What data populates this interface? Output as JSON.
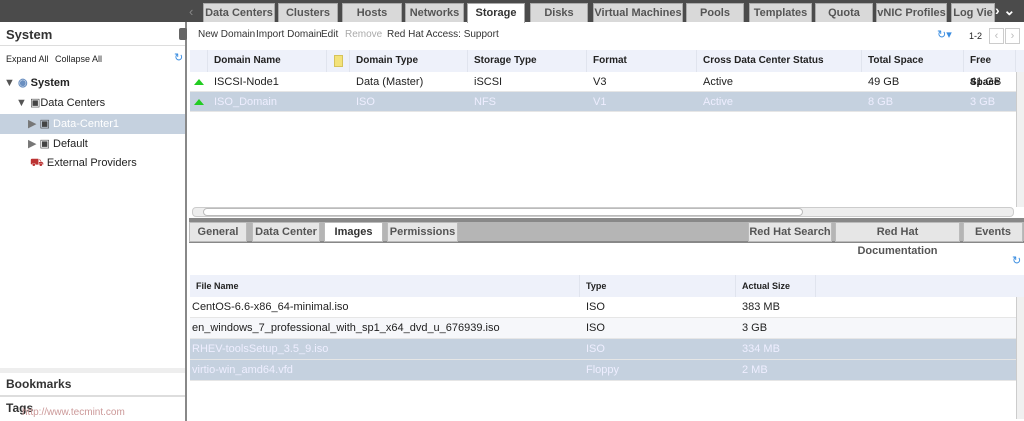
{
  "main_tabs": [
    "Data Centers",
    "Clusters",
    "Hosts",
    "Networks",
    "Storage",
    "Disks",
    "Virtual Machines",
    "Pools",
    "Templates",
    "Quota",
    "vNIC Profiles",
    "Log Vie"
  ],
  "active_tab": "Storage",
  "left": {
    "title": "System",
    "expand_all": "Expand All",
    "collapse_all": "Collapse All",
    "tree": [
      "System",
      "Data Centers",
      "Data-Center1",
      "Default",
      "External Providers"
    ],
    "bookmarks": "Bookmarks",
    "tags": "Tags"
  },
  "toolbar": {
    "new_domain": "New Domain",
    "import_domain": "Import Domain",
    "edit": "Edit",
    "remove": "Remove",
    "support": "Red Hat Access: Support",
    "pager": "1-2"
  },
  "storage_table": {
    "headers": [
      "Domain Name",
      "Domain Type",
      "Storage Type",
      "Format",
      "Cross Data Center Status",
      "Total Space",
      "Free Space"
    ],
    "rows": [
      [
        "ISCSI-Node1",
        "Data (Master)",
        "iSCSI",
        "V3",
        "Active",
        "49 GB",
        "41 GB"
      ],
      [
        "ISO_Domain",
        "ISO",
        "NFS",
        "V1",
        "Active",
        "8 GB",
        "3 GB"
      ]
    ]
  },
  "sub_tabs": [
    "General",
    "Data Center",
    "Images",
    "Permissions"
  ],
  "right_tabs": [
    "Red Hat Search",
    "Red Hat Documentation",
    "Events"
  ],
  "images_table": {
    "headers": [
      "File Name",
      "Type",
      "Actual Size"
    ],
    "rows": [
      [
        "CentOS-6.6-x86_64-minimal.iso",
        "ISO",
        "383 MB"
      ],
      [
        "en_windows_7_professional_with_sp1_x64_dvd_u_676939.iso",
        "ISO",
        "3 GB"
      ],
      [
        "RHEV-toolsSetup_3.5_9.iso",
        "ISO",
        "334 MB"
      ],
      [
        "virtio-win_amd64.vfd",
        "Floppy",
        "2 MB"
      ]
    ]
  },
  "watermark": "http://www.tecmint.com"
}
